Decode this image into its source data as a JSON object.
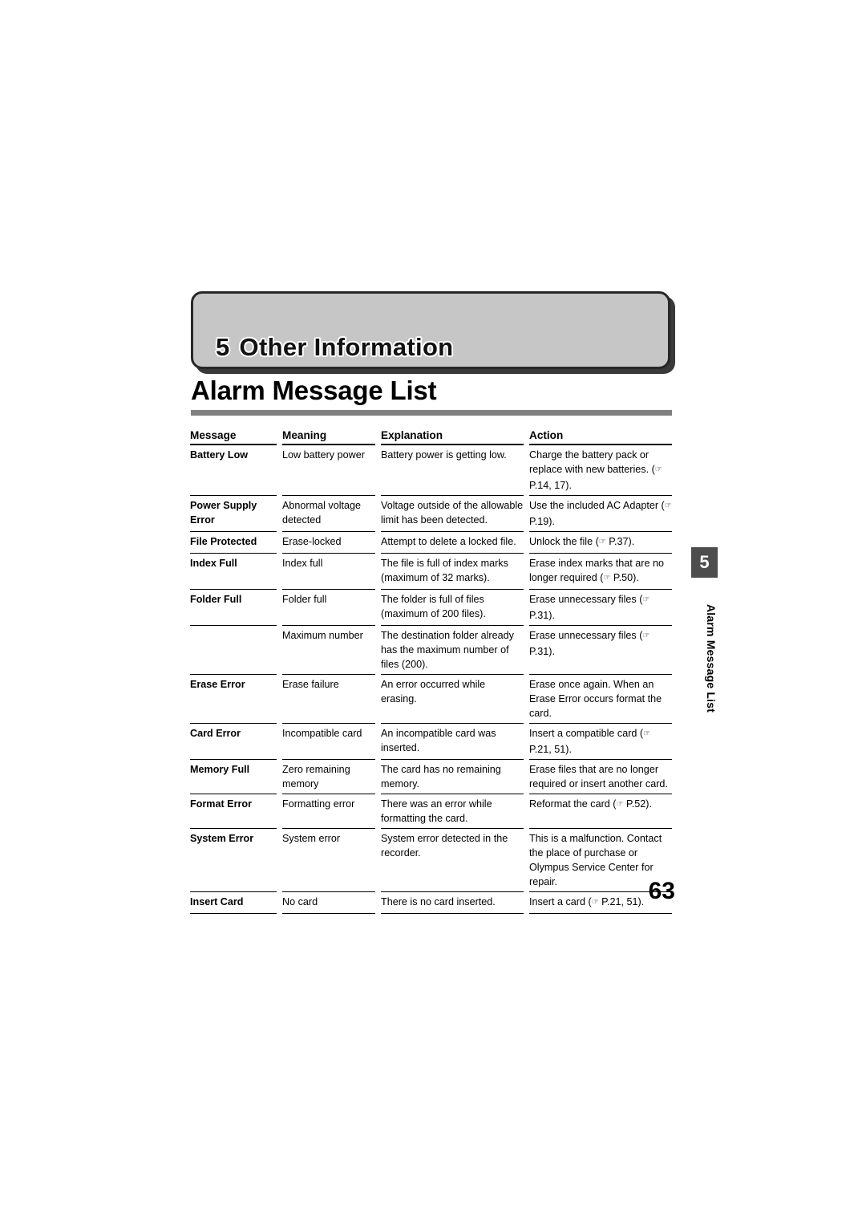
{
  "chapter": {
    "number": "5",
    "title": "Other Information"
  },
  "section": {
    "title": "Alarm Message List"
  },
  "side_tab": {
    "number": "5",
    "label": "Alarm Message List"
  },
  "folio": {
    "page_number": "63"
  },
  "table": {
    "headers": [
      "Message",
      "Meaning",
      "Explanation",
      "Action"
    ],
    "rows": [
      {
        "message": "Battery Low",
        "meaning": "Low battery power",
        "explanation": "Battery power is getting low.",
        "action_pre": "Charge the battery pack or replace with new batteries. (",
        "action_ref": "P.14, 17).",
        "has_hand": true
      },
      {
        "message": "Power Supply Error",
        "meaning": "Abnormal voltage detected",
        "explanation": "Voltage outside of the allowable limit has been detected.",
        "action_pre": "Use the included AC Adapter (",
        "action_ref": "P.19).",
        "has_hand": true
      },
      {
        "message": "File Protected",
        "meaning": "Erase-locked",
        "explanation": "Attempt to delete a locked file.",
        "action_pre": "Unlock the file (",
        "action_ref": "P.37).",
        "has_hand": true
      },
      {
        "message": "Index Full",
        "meaning": "Index full",
        "explanation": "The file is full of index marks (maximum of 32 marks).",
        "action_pre": "Erase index marks that are no longer required (",
        "action_ref": "P.50).",
        "has_hand": true
      },
      {
        "message": "Folder Full",
        "meaning": "Folder full",
        "explanation": "The folder is full of files (maximum of 200 files).",
        "action_pre": "Erase unnecessary files (",
        "action_ref": "P.31).",
        "has_hand": true
      },
      {
        "message": "",
        "meaning": "Maximum number",
        "explanation": "The destination folder already has the maximum number of files (200).",
        "action_pre": "Erase unnecessary files (",
        "action_ref": "P.31).",
        "has_hand": true
      },
      {
        "message": "Erase Error",
        "meaning": "Erase failure",
        "explanation": "An error occurred while erasing.",
        "action_pre": "Erase once again. When an Erase Error occurs format the card.",
        "action_ref": "",
        "has_hand": false
      },
      {
        "message": "Card Error",
        "meaning": "Incompatible card",
        "explanation": "An incompatible card was inserted.",
        "action_pre": "Insert a compatible card (",
        "action_ref": "P.21, 51).",
        "has_hand": true
      },
      {
        "message": "Memory Full",
        "meaning": "Zero remaining memory",
        "explanation": "The card has no remaining memory.",
        "action_pre": "Erase files that are no longer required or insert another card.",
        "action_ref": "",
        "has_hand": false
      },
      {
        "message": "Format Error",
        "meaning": "Formatting error",
        "explanation": "There was an error while formatting the card.",
        "action_pre": "Reformat the card (",
        "action_ref": "P.52).",
        "has_hand": true
      },
      {
        "message": "System Error",
        "meaning": "System error",
        "explanation": "System error detected in the recorder.",
        "action_pre": "This is a malfunction. Contact the place of purchase or Olympus Service Center for repair.",
        "action_ref": "",
        "has_hand": false
      },
      {
        "message": "Insert Card",
        "meaning": "No card",
        "explanation": "There is no card inserted.",
        "action_pre": "Insert a card (",
        "action_ref": "P.21, 51).",
        "has_hand": true
      }
    ]
  },
  "icons": {
    "pointing-hand": "☞"
  }
}
